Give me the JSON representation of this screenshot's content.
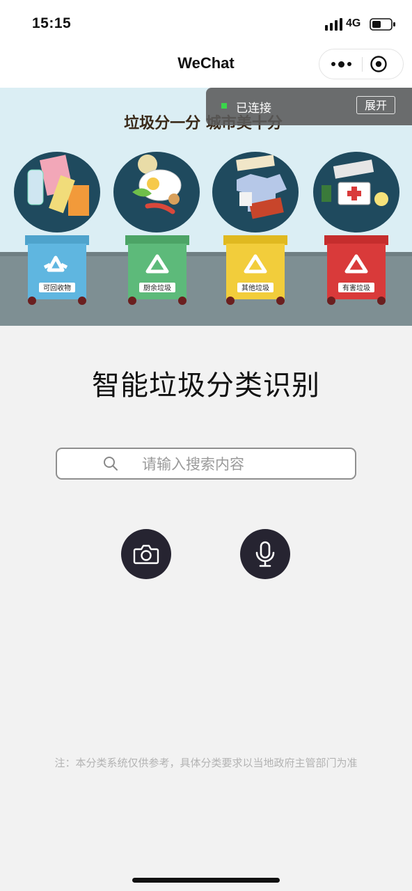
{
  "status_bar": {
    "time": "15:15",
    "network": "4G",
    "icons": [
      "signal-icon",
      "battery-icon"
    ]
  },
  "nav": {
    "title": "WeChat",
    "icons": [
      "more-icon",
      "close-circle-icon"
    ]
  },
  "banner": {
    "slogan": "垃圾分一分 城市美十分",
    "bins": [
      {
        "label": "可回收物",
        "color": "#5fb6e0"
      },
      {
        "label": "厨余垃圾",
        "color": "#5dba7a"
      },
      {
        "label": "其他垃圾",
        "color": "#f2cd3b"
      },
      {
        "label": "有害垃圾",
        "color": "#d93a3a"
      }
    ],
    "sky_color": "#dbeef4",
    "ground_color": "#7e8f93"
  },
  "connection": {
    "status": "已连接",
    "expand_label": "展开",
    "indicator_color": "#3bd64b"
  },
  "main": {
    "title": "智能垃圾分类识别",
    "search_placeholder": "请输入搜索内容",
    "buttons": [
      {
        "name": "camera",
        "icon": "camera-icon"
      },
      {
        "name": "voice",
        "icon": "microphone-icon"
      }
    ],
    "footnote": "注：本分类系统仅供参考，具体分类要求以当地政府主管部门为准"
  },
  "colors": {
    "background": "#f2f2f2",
    "button_bg": "#262431",
    "accent_green": "#3bd64b"
  }
}
